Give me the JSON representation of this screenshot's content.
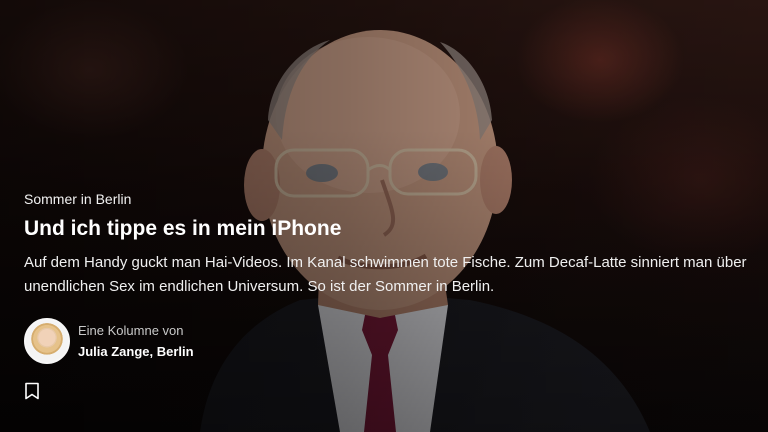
{
  "article": {
    "kicker": "Sommer in Berlin",
    "headline": "Und ich tippe es in mein iPhone",
    "teaser": "Auf dem Handy guckt man Hai-Videos. Im Kanal schwimmen tote Fische. Zum Decaf-Latte sinniert man über unendlichen Sex im endlichen Universum. So ist der Sommer in Berlin."
  },
  "author": {
    "prefix": "Eine Kolumne von",
    "name": "Julia Zange, Berlin"
  },
  "actions": {
    "bookmark_icon": "bookmark-icon"
  },
  "colors": {
    "text": "#ffffff",
    "muted": "#c9c9c9"
  }
}
